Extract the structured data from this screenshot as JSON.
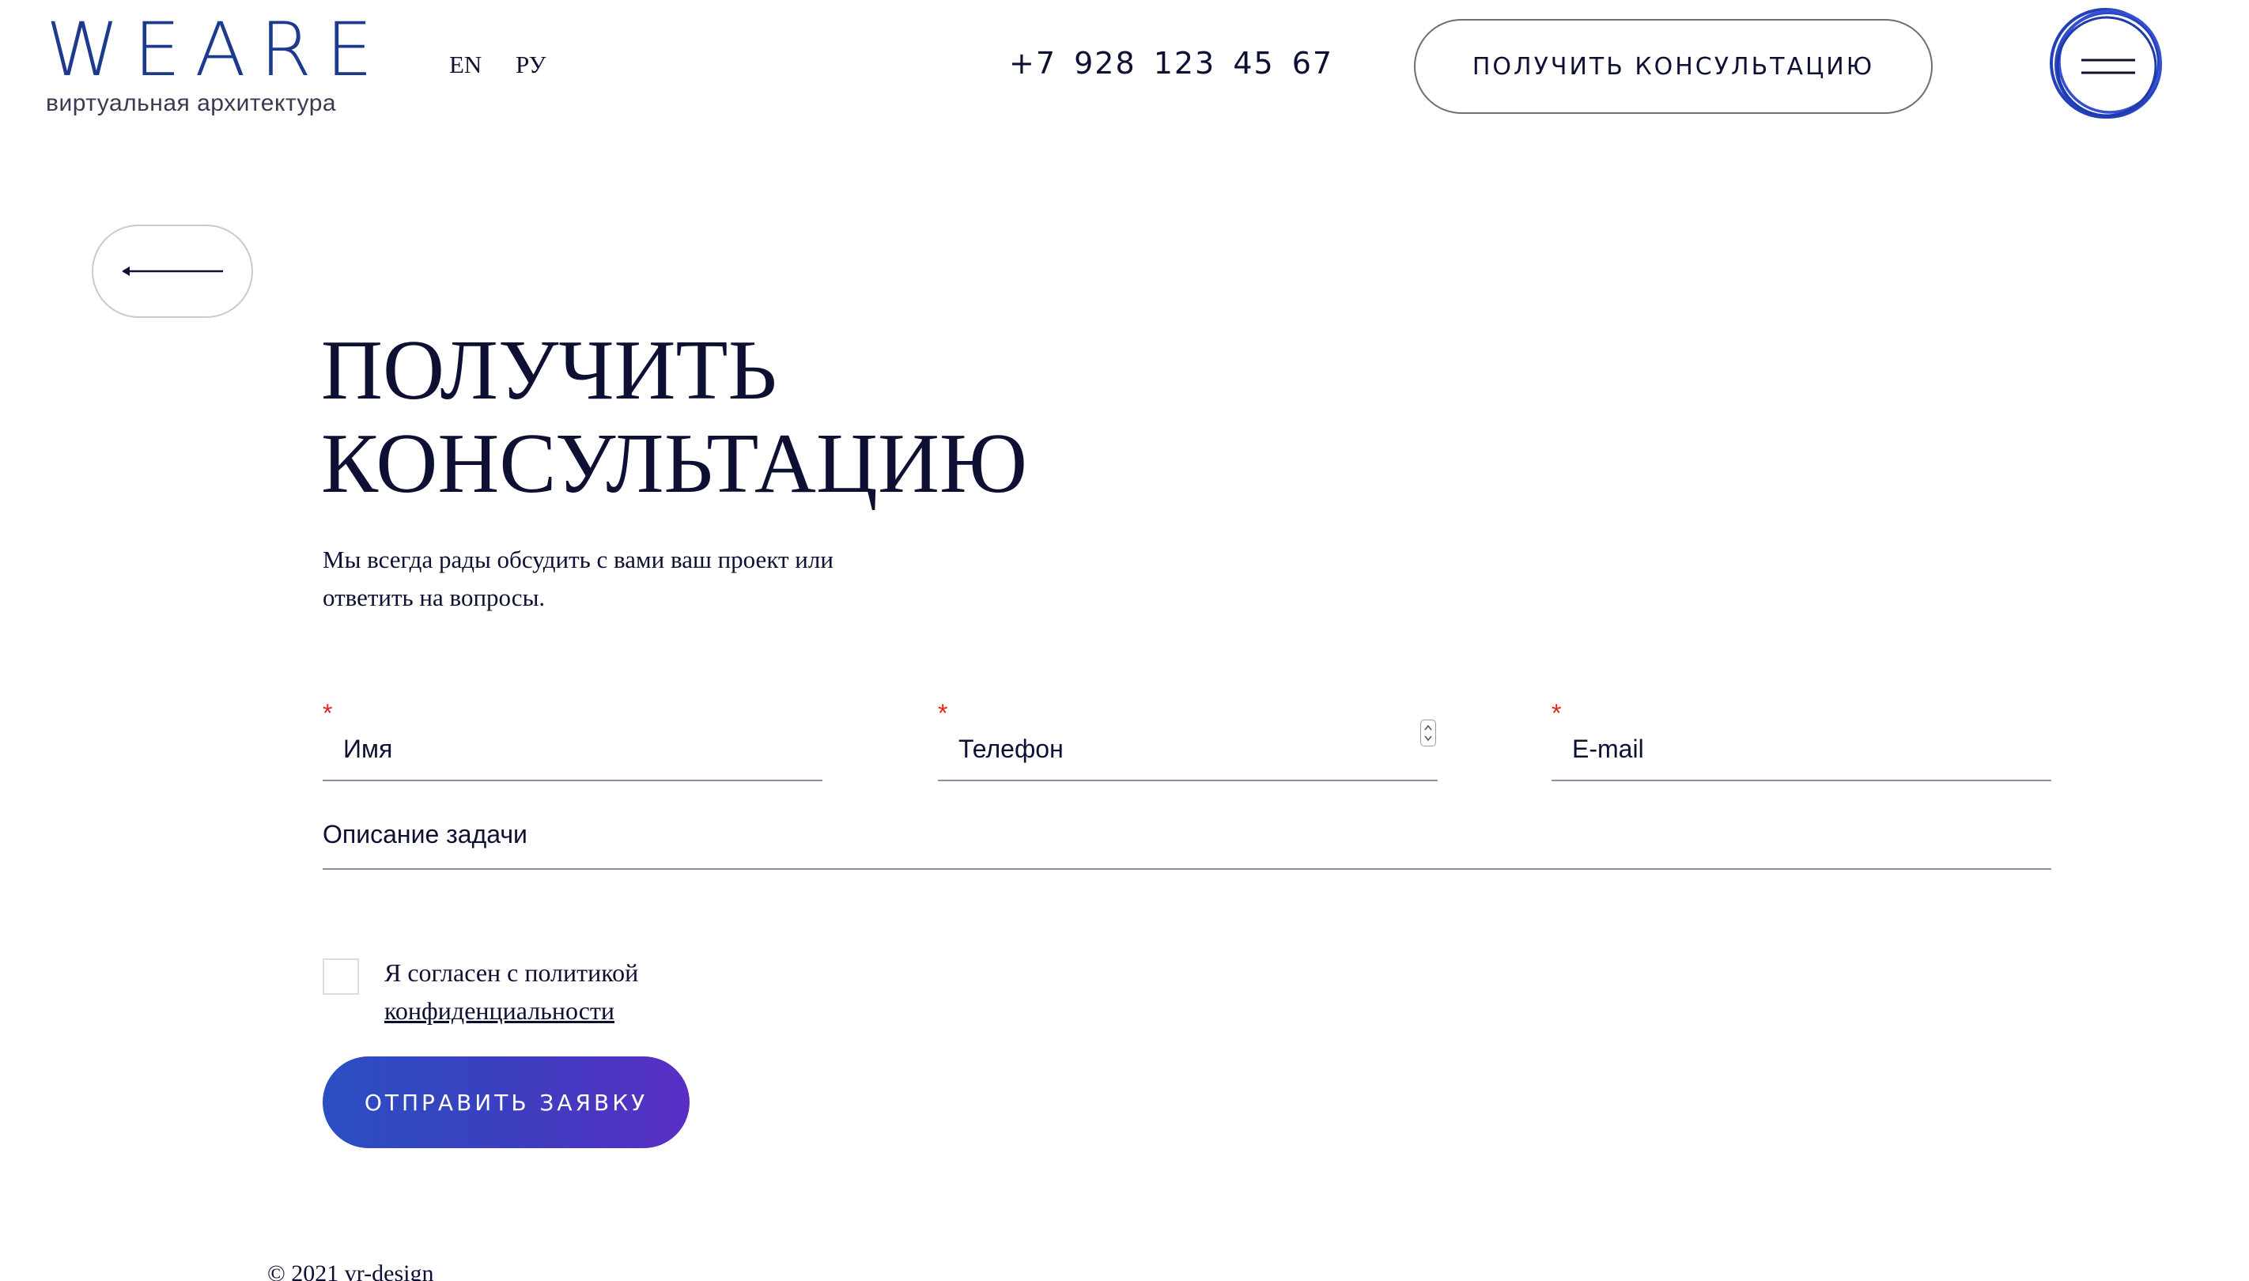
{
  "header": {
    "logo_word": "WEARE",
    "logo_tagline": "виртуальная архитектура",
    "languages": [
      "EN",
      "РУ"
    ],
    "phone": "+7 928 123 45 67",
    "cta_label": "ПОЛУЧИТЬ КОНСУЛЬТАЦИЮ",
    "menu_icon": "burger-menu-icon"
  },
  "back_button": {
    "icon": "arrow-left-icon"
  },
  "page": {
    "title_line1": "ПОЛУЧИТЬ",
    "title_line2": "КОНСУЛЬТАЦИЮ",
    "lead": "Мы всегда рады обсудить с вами ваш проект или ответить на вопросы."
  },
  "form": {
    "required_mark": "*",
    "name_placeholder": "Имя",
    "phone_placeholder": "Телефон",
    "email_placeholder": "E-mail",
    "description_placeholder": "Описание задачи",
    "consent_text": "Я согласен с политикой",
    "consent_link": "конфиденциальности",
    "submit_label": "ОТПРАВИТЬ ЗАЯВКУ"
  },
  "footer": {
    "copyright": "© 2021 vr-design"
  },
  "colors": {
    "brand_blue": "#1d3a8f",
    "accent_gradient_start": "#2a4fc2",
    "accent_gradient_end": "#5a2ec4",
    "required": "#e0261b",
    "text": "#0d1033"
  }
}
